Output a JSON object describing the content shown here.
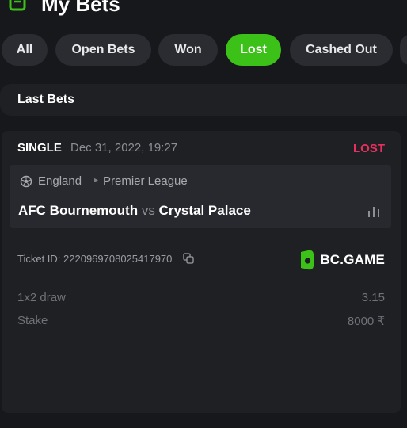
{
  "header": {
    "title": "My Bets"
  },
  "filters": [
    {
      "label": "All",
      "active": false
    },
    {
      "label": "Open Bets",
      "active": false
    },
    {
      "label": "Won",
      "active": false
    },
    {
      "label": "Lost",
      "active": true
    },
    {
      "label": "Cashed Out",
      "active": false
    }
  ],
  "section": {
    "label": "Last Bets"
  },
  "bet": {
    "type": "SINGLE",
    "date": "Dec 31, 2022, 19:27",
    "status": "LOST",
    "country": "England",
    "league": "Premier League",
    "home_team": "AFC Bournemouth",
    "vs": "vs",
    "away_team": "Crystal Palace",
    "ticket_id": "Ticket ID: 2220969708025417970",
    "brand": "BC.GAME",
    "selection_label": "1x2 draw",
    "selection_odds": "3.15",
    "stake_label": "Stake",
    "stake_value": "8000 ₹"
  },
  "colors": {
    "accent": "#3bc117",
    "lost": "#e8305f",
    "background": "#17181b",
    "card": "#1e2023"
  },
  "icons": {
    "header": "bet-slip-icon",
    "sport": "soccer-ball-icon",
    "separator": "chevron-right-icon",
    "stats": "stats-bars-icon",
    "copy": "copy-icon",
    "brand": "bc-game-logo-icon"
  }
}
